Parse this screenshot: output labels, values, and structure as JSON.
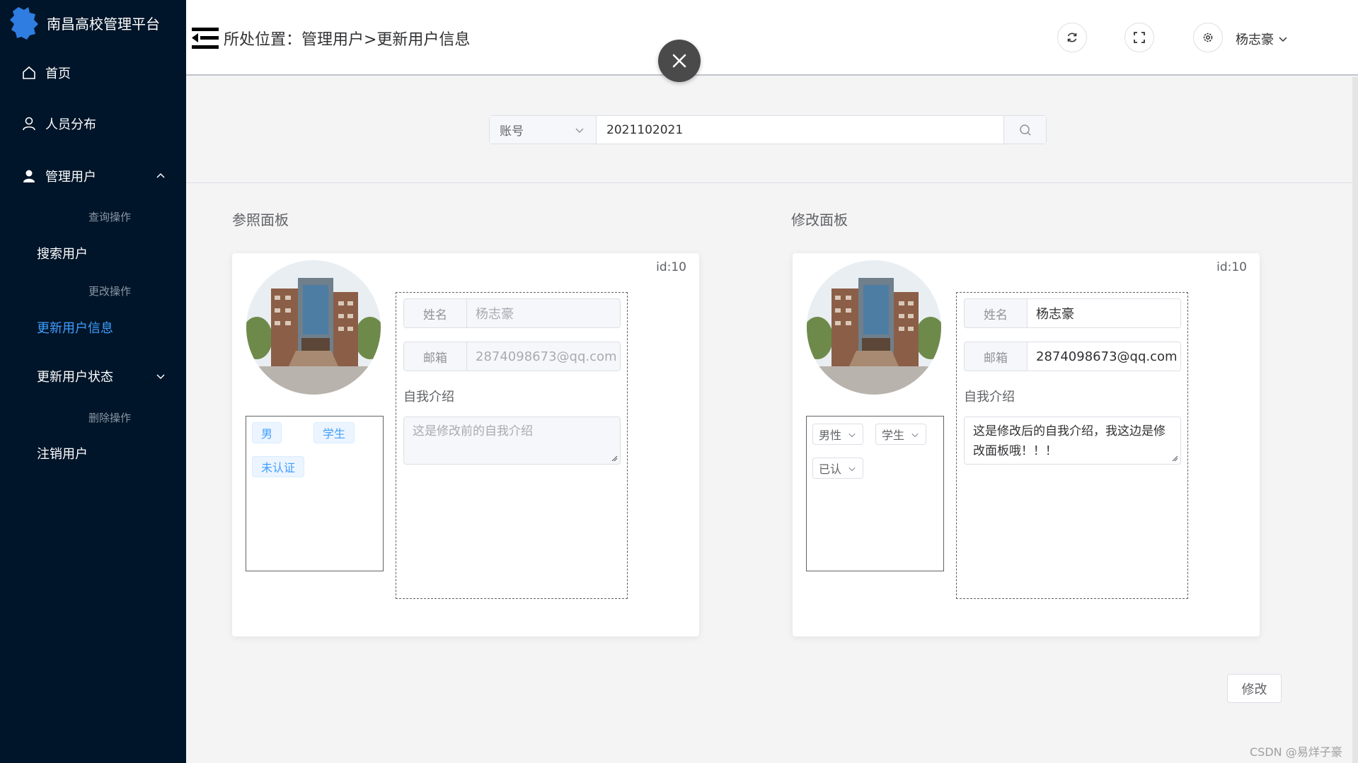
{
  "app": {
    "title": "南昌高校管理平台"
  },
  "sidebar": {
    "home": "首页",
    "people": "人员分布",
    "manage": "管理用户",
    "group_query": "查询操作",
    "search_user": "搜索用户",
    "group_modify": "更改操作",
    "update_user_info": "更新用户信息",
    "update_user_status": "更新用户状态",
    "group_delete": "删除操作",
    "cancel_user": "注销用户"
  },
  "header": {
    "breadcrumb": "所处位置：管理用户>更新用户信息",
    "username": "杨志豪"
  },
  "search": {
    "select_value": "账号",
    "input_value": "2021102021"
  },
  "reference_panel": {
    "title": "参照面板",
    "id_text": "id:10",
    "tags": [
      "男",
      "学生",
      "未认证"
    ],
    "name_label": "姓名",
    "name_value": "杨志豪",
    "email_label": "邮箱",
    "email_value": "2874098673@qq.com",
    "intro_label": "自我介绍",
    "intro_value": "这是修改前的自我介绍"
  },
  "modify_panel": {
    "title": "修改面板",
    "id_text": "id:10",
    "selects": [
      "男性",
      "学生",
      "已认"
    ],
    "name_label": "姓名",
    "name_value": "杨志豪",
    "email_label": "邮箱",
    "email_value": "2874098673@qq.com",
    "intro_label": "自我介绍",
    "intro_value": "这是修改后的自我介绍，我这边是修改面板哦！！！"
  },
  "actions": {
    "submit": "修改"
  },
  "watermark": "CSDN @易烊子豪",
  "colors": {
    "sidebar_bg": "#001529",
    "accent": "#409eff",
    "page_bg": "#f4f4f5"
  },
  "icons": [
    "refresh-icon",
    "fullscreen-icon",
    "gear-icon",
    "search-icon",
    "close-icon",
    "home-icon",
    "user-outline-icon",
    "user-filled-icon"
  ]
}
